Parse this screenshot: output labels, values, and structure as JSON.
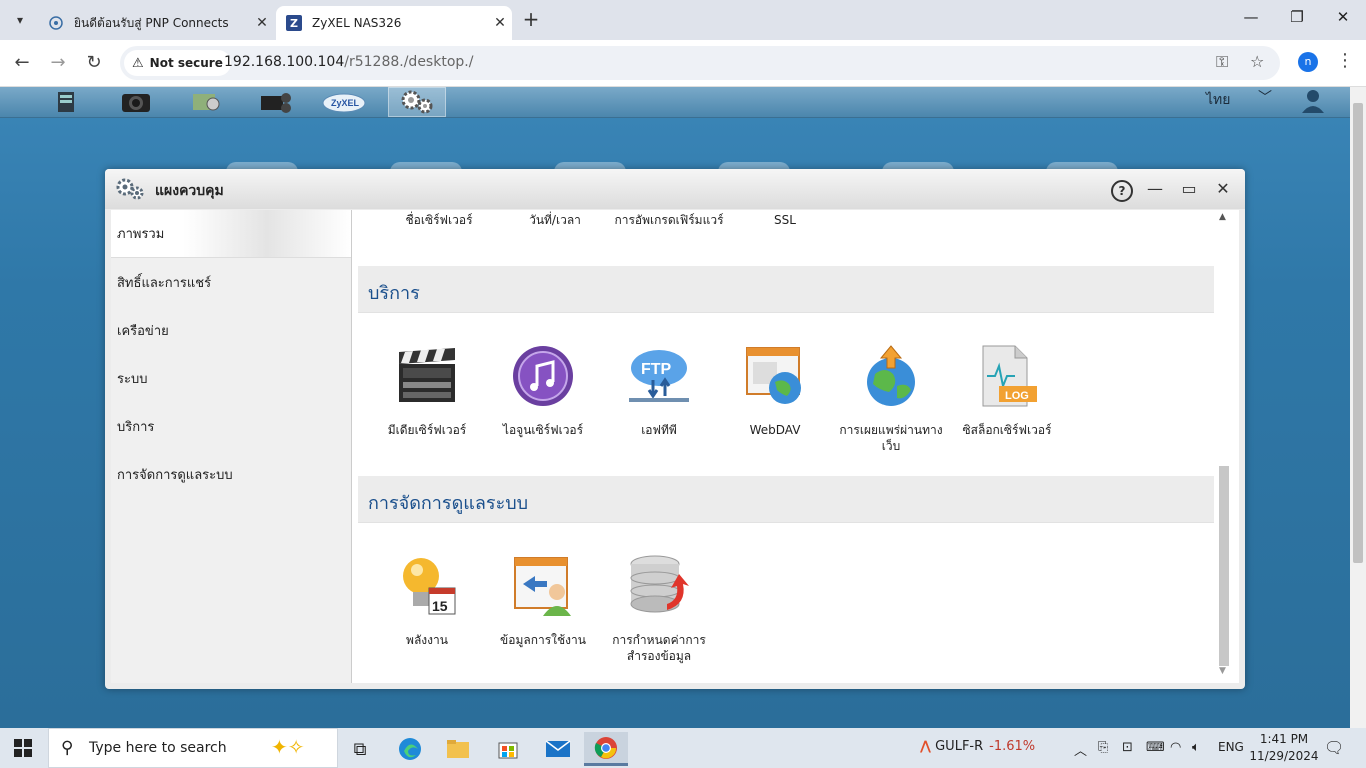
{
  "browser": {
    "tabs": [
      {
        "title": "ยินดีต้อนรับสู่ PNP Connects",
        "favicon": "globe-gear-icon"
      },
      {
        "title": "ZyXEL NAS326",
        "favicon": "zyxel-z-icon"
      }
    ],
    "security_label": "Not secure",
    "url_host": "192.168.100.104",
    "url_path": "/r51288./desktop./",
    "profile_initial": "n"
  },
  "nas": {
    "language": "ไทย"
  },
  "window": {
    "title": "แผงควบคุม",
    "help_glyph": "?",
    "sidebar": [
      {
        "label": "ภาพรวม"
      },
      {
        "label": "สิทธิ์และการแชร์"
      },
      {
        "label": "เครือข่าย"
      },
      {
        "label": "ระบบ"
      },
      {
        "label": "บริการ"
      },
      {
        "label": "การจัดการดูแลระบบ"
      }
    ],
    "top_labels": [
      {
        "label": "ชื่อเซิร์ฟเวอร์"
      },
      {
        "label": "วันที่/เวลา"
      },
      {
        "label": "การอัพเกรดเฟิร์มแวร์"
      },
      {
        "label": "SSL"
      }
    ],
    "services": {
      "heading": "บริการ",
      "items": [
        {
          "label": "มีเดียเซิร์ฟเวอร์",
          "icon": "media-clapperboard-icon"
        },
        {
          "label": "ไอจูนเซิร์ฟเวอร์",
          "icon": "itunes-music-icon"
        },
        {
          "label": "เอฟทีพี",
          "icon": "ftp-cloud-icon"
        },
        {
          "label": "WebDAV",
          "icon": "webdav-globe-icon"
        },
        {
          "label": "การเผยแพร่ผ่านทางเว็บ",
          "icon": "web-publish-globe-icon"
        },
        {
          "label": "ซิสล็อกเซิร์ฟเวอร์",
          "icon": "syslog-document-icon"
        }
      ]
    },
    "management": {
      "heading": "การจัดการดูแลระบบ",
      "items": [
        {
          "label": "พลังงาน",
          "icon": "power-bulb-calendar-icon"
        },
        {
          "label": "ข้อมูลการใช้งาน",
          "icon": "usage-user-icon"
        },
        {
          "label": "การกำหนดค่าการสำรองข้อมูล",
          "icon": "backup-database-icon"
        }
      ]
    }
  },
  "taskbar": {
    "search_placeholder": "Type here to search",
    "ticker": "GULF-R",
    "ticker_change": "-1.61%",
    "lang": "ENG",
    "time": "1:41 PM",
    "date": "11/29/2024"
  }
}
